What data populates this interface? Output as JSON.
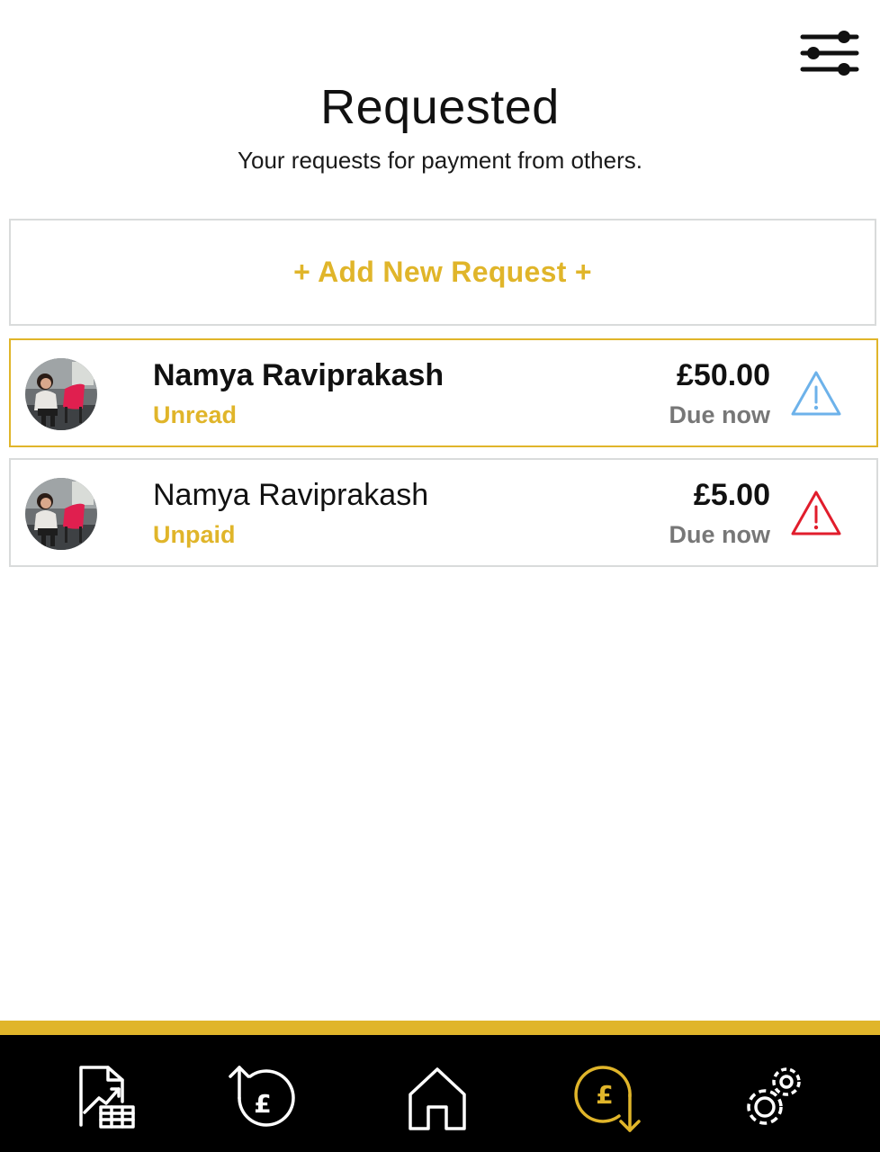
{
  "header": {
    "title": "Requested",
    "subtitle": "Your requests for payment from others."
  },
  "filter": {
    "icon": "sliders-icon"
  },
  "add_request": {
    "label": "+ Add New Request +"
  },
  "requests": [
    {
      "name": "Namya Raviprakash",
      "status": "Unread",
      "amount": "£50.00",
      "due": "Due now",
      "warning_color": "#6db2ea",
      "selected": true
    },
    {
      "name": "Namya Raviprakash",
      "status": "Unpaid",
      "amount": "£5.00",
      "due": "Due now",
      "warning_color": "#e11d2c",
      "selected": false
    }
  ],
  "tabbar": {
    "tabs": [
      {
        "icon": "statements-icon",
        "active": false
      },
      {
        "icon": "send-money-icon",
        "active": false
      },
      {
        "icon": "home-icon",
        "active": false
      },
      {
        "icon": "request-money-icon",
        "active": true
      },
      {
        "icon": "settings-icon",
        "active": false
      }
    ]
  },
  "colors": {
    "accent": "#e0b52a",
    "text": "#111111",
    "muted": "#777777",
    "border": "#d9dbdb",
    "tabbar_bg": "#000000"
  }
}
